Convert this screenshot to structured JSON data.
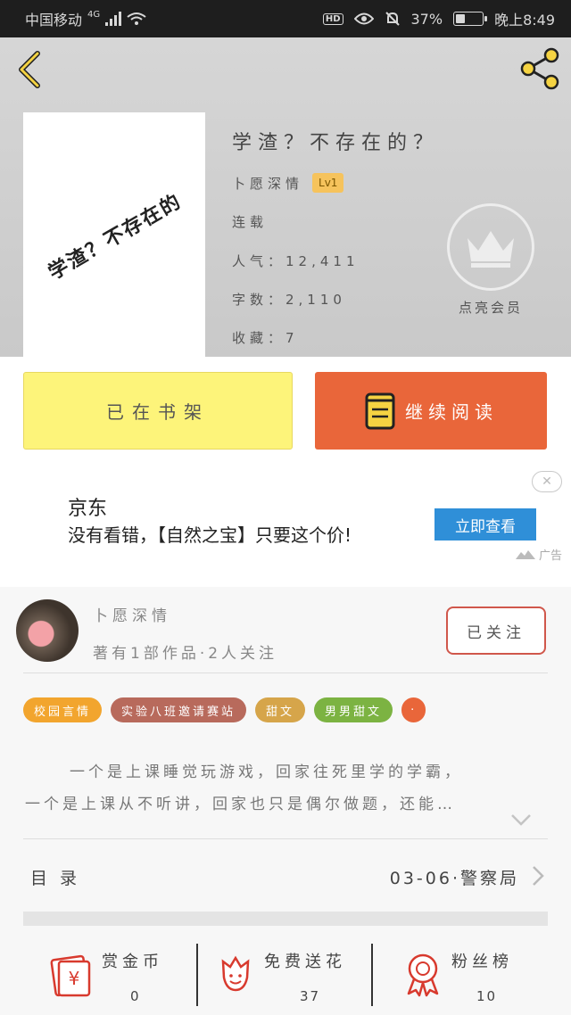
{
  "status": {
    "carrier": "中国移动",
    "network": "4G",
    "hd": "HD",
    "battery_percent": "37%",
    "time": "晚上8:49",
    "battery_level": 0.37
  },
  "book": {
    "cover_text": "学渣？不存在的",
    "title": "学渣？不存在的？",
    "author": "卜愿深情",
    "level": "Lv1",
    "status": "连载",
    "popularity": "人气：12,411",
    "word_count": "字数：2,110",
    "favorites": "收藏：7"
  },
  "member": {
    "label": "点亮会员"
  },
  "actions": {
    "shelf_label": "已在书架",
    "read_label": "继续阅读"
  },
  "ad": {
    "brand": "京东",
    "text": "没有看错，【自然之宝】只要这个价!",
    "cta": "立即查看",
    "close": "✕",
    "tag": "广告"
  },
  "author": {
    "name": "卜愿深情",
    "stats": "著有1部作品·2人关注",
    "follow_label": "已关注"
  },
  "tags": [
    {
      "label": "校园言情",
      "color": "#f2a52e"
    },
    {
      "label": "实验八班邀请赛站",
      "color": "#b86a5c"
    },
    {
      "label": "甜文",
      "color": "#d6a54a"
    },
    {
      "label": "男男甜文",
      "color": "#7cb342"
    },
    {
      "label": "·",
      "color": "#e9663a"
    }
  ],
  "summary": {
    "line1": "一个是上课睡觉玩游戏，回家往死里学的学霸，",
    "line2": "一个是上课从不听讲，回家也只是偶尔做题，还能…"
  },
  "toc": {
    "label": "目录",
    "latest": "03-06·警察局"
  },
  "stats": {
    "reward": {
      "label": "赏金币",
      "value": "0"
    },
    "flowers": {
      "label": "免费送花",
      "value": "37"
    },
    "fans": {
      "label": "粉丝榜",
      "value": "10"
    }
  },
  "colors": {
    "shelf_button": "#fdf47a",
    "read_button": "#e9663a",
    "accent_red": "#d0574b",
    "ad_button": "#2f8fd8"
  }
}
